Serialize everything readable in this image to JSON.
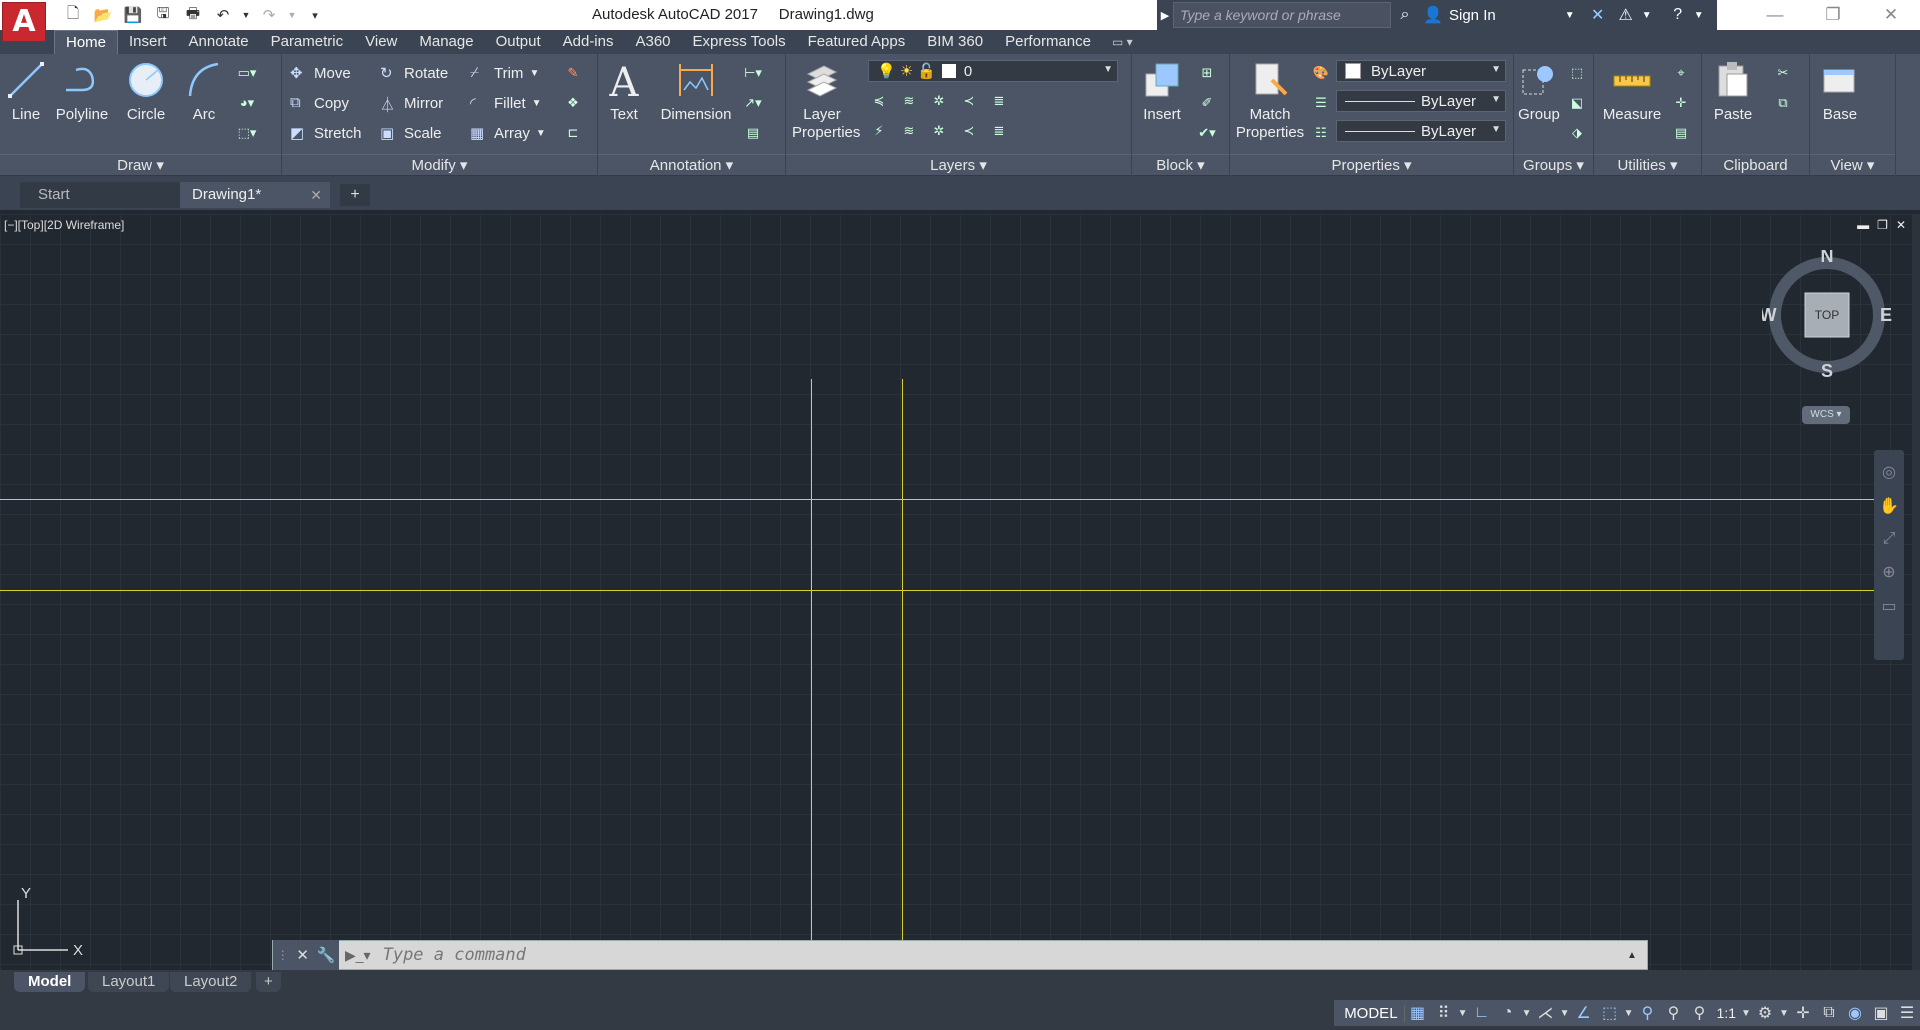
{
  "app": {
    "icon_letter": "A",
    "title": "Autodesk AutoCAD 2017     Drawing1.dwg",
    "search_placeholder": "Type a keyword or phrase",
    "sign_in": "Sign In"
  },
  "ribbon_tabs": [
    "Home",
    "Insert",
    "Annotate",
    "Parametric",
    "View",
    "Manage",
    "Output",
    "Add-ins",
    "A360",
    "Express Tools",
    "Featured Apps",
    "BIM 360",
    "Performance"
  ],
  "panels": {
    "draw": {
      "title": "Draw",
      "line": "Line",
      "polyline": "Polyline",
      "circle": "Circle",
      "arc": "Arc"
    },
    "modify": {
      "title": "Modify",
      "move": "Move",
      "rotate": "Rotate",
      "trim": "Trim",
      "copy": "Copy",
      "mirror": "Mirror",
      "fillet": "Fillet",
      "stretch": "Stretch",
      "scale": "Scale",
      "array": "Array"
    },
    "annotation": {
      "title": "Annotation",
      "text": "Text",
      "dimension": "Dimension"
    },
    "layers": {
      "title": "Layers",
      "layer_properties_1": "Layer",
      "layer_properties_2": "Properties",
      "current_layer": "0"
    },
    "block": {
      "title": "Block",
      "insert": "Insert"
    },
    "properties": {
      "title": "Properties",
      "match_1": "Match",
      "match_2": "Properties",
      "color": "ByLayer",
      "linetype": "ByLayer",
      "lineweight": "ByLayer"
    },
    "groups": {
      "title": "Groups",
      "group": "Group"
    },
    "utilities": {
      "title": "Utilities",
      "measure": "Measure"
    },
    "clipboard": {
      "title": "Clipboard",
      "paste": "Paste"
    },
    "view": {
      "title": "View",
      "base": "Base"
    }
  },
  "file_tabs": [
    {
      "label": "Start"
    },
    {
      "label": "Drawing1*"
    }
  ],
  "viewport": {
    "label": "[−][Top][2D Wireframe]",
    "viewcube": {
      "n": "N",
      "s": "S",
      "e": "E",
      "w": "W",
      "face": "TOP"
    },
    "wcs": "WCS",
    "ucs_x": "X",
    "ucs_y": "Y"
  },
  "command": {
    "placeholder": "Type a command"
  },
  "layout_tabs": [
    "Model",
    "Layout1",
    "Layout2"
  ],
  "status": {
    "model": "MODEL",
    "scale": "1:1"
  },
  "colors": {
    "accent": "#c8282e",
    "line": "#d8d02c",
    "bg": "#212830",
    "ribbon": "#4b5565"
  }
}
